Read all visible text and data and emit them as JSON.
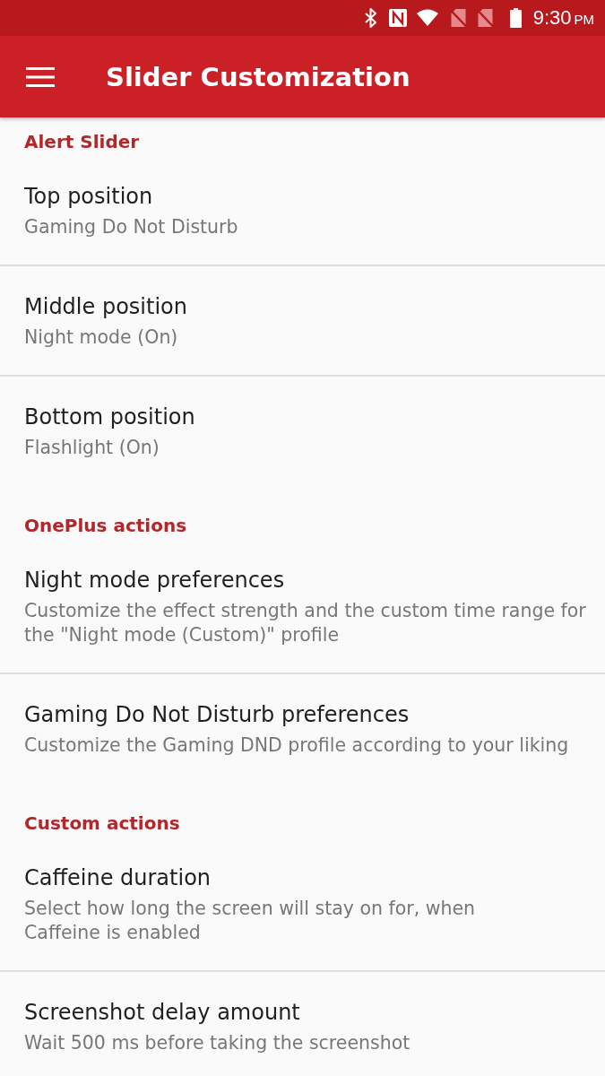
{
  "status_bar": {
    "time": "9:30",
    "period": "PM"
  },
  "app_bar": {
    "title": "Slider Customization"
  },
  "sections": [
    {
      "title": "Alert Slider",
      "items": [
        {
          "title": "Top position",
          "summary": "Gaming Do Not Disturb"
        },
        {
          "title": "Middle position",
          "summary": "Night mode (On)"
        },
        {
          "title": "Bottom position",
          "summary": "Flashlight (On)"
        }
      ]
    },
    {
      "title": "OnePlus actions",
      "items": [
        {
          "title": "Night mode preferences",
          "summary": "Customize the effect strength and the custom time range for the \"Night mode (Custom)\" profile"
        },
        {
          "title": "Gaming Do Not Disturb preferences",
          "summary": "Customize the Gaming DND profile according to your liking"
        }
      ]
    },
    {
      "title": "Custom actions",
      "items": [
        {
          "title": "Caffeine duration",
          "summary": "Select how long the screen will stay on for, when\nCaffeine is enabled"
        },
        {
          "title": "Screenshot delay amount",
          "summary": "Wait 500 ms before taking the screenshot"
        }
      ]
    }
  ]
}
